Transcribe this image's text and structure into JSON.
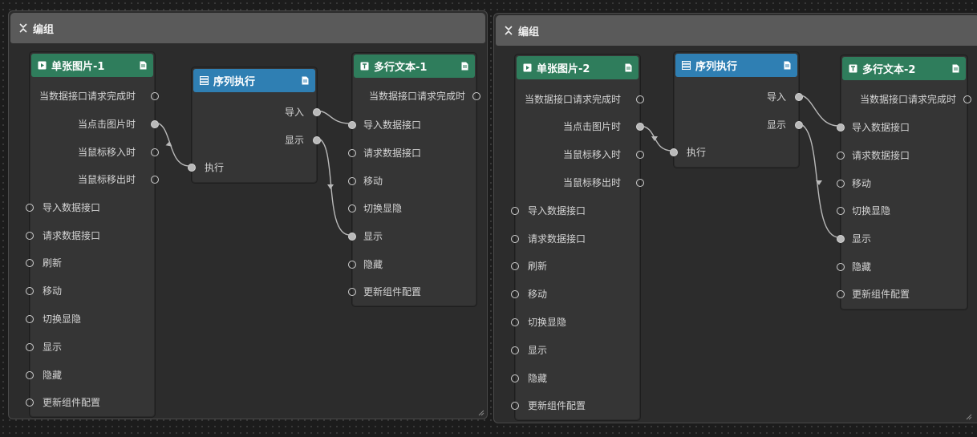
{
  "groups": [
    {
      "title": "编组",
      "image_node": {
        "title": "单张图片-1",
        "outputs": [
          "当数据接口请求完成时",
          "当点击图片时",
          "当鼠标移入时",
          "当鼠标移出时"
        ],
        "inputs": [
          "导入数据接口",
          "请求数据接口",
          "刷新",
          "移动",
          "切换显隐",
          "显示",
          "隐藏",
          "更新组件配置"
        ]
      },
      "seq_node": {
        "title": "序列执行",
        "outputs": [
          "导入",
          "显示"
        ],
        "inputs": [
          "执行"
        ]
      },
      "text_node": {
        "title": "多行文本-1",
        "outputs": [
          "当数据接口请求完成时"
        ],
        "inputs": [
          "导入数据接口",
          "请求数据接口",
          "移动",
          "切换显隐",
          "显示",
          "隐藏",
          "更新组件配置"
        ]
      }
    },
    {
      "title": "编组",
      "image_node": {
        "title": "单张图片-2",
        "outputs": [
          "当数据接口请求完成时",
          "当点击图片时",
          "当鼠标移入时",
          "当鼠标移出时"
        ],
        "inputs": [
          "导入数据接口",
          "请求数据接口",
          "刷新",
          "移动",
          "切换显隐",
          "显示",
          "隐藏",
          "更新组件配置"
        ]
      },
      "seq_node": {
        "title": "序列执行",
        "outputs": [
          "导入",
          "显示"
        ],
        "inputs": [
          "执行"
        ]
      },
      "text_node": {
        "title": "多行文本-2",
        "outputs": [
          "当数据接口请求完成时"
        ],
        "inputs": [
          "导入数据接口",
          "请求数据接口",
          "移动",
          "切换显隐",
          "显示",
          "隐藏",
          "更新组件配置"
        ]
      }
    }
  ],
  "colors": {
    "image_header": "#2f7d5c",
    "seq_header": "#2f7fb3",
    "text_header": "#2f7d5c",
    "wire": "#b9b9b9"
  },
  "icons": {
    "collapse": "collapse-icon",
    "image_node": "play-icon",
    "seq_node": "sequence-icon",
    "text_node": "text-t-icon",
    "doc": "document-icon"
  }
}
